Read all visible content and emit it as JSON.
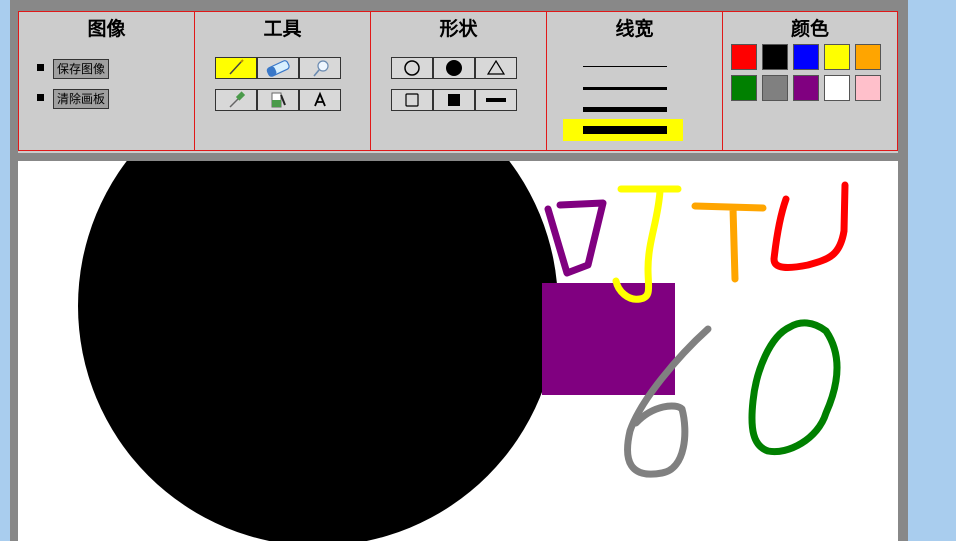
{
  "toolbar": {
    "image_panel": {
      "title": "图像",
      "save_label": "保存图像",
      "clear_label": "清除画板"
    },
    "tools_panel": {
      "title": "工具",
      "active_tool": "pencil"
    },
    "shapes_panel": {
      "title": "形状"
    },
    "width_panel": {
      "title": "线宽",
      "active_width_index": 3
    },
    "color_panel": {
      "title": "颜色",
      "colors": [
        "#ff0000",
        "#000000",
        "#0000ff",
        "#ffff00",
        "#ffa500",
        "#008000",
        "#808080",
        "#800080",
        "#ffffff",
        "#ffc0cb"
      ]
    }
  },
  "canvas": {
    "background": "#ffffff",
    "drawings": {
      "circle_color": "#000000",
      "rect_color": "#800080",
      "stroke_colors": {
        "letter_d": "#800080",
        "letter_j": "#ffff00",
        "letter_t": "#ffa500",
        "letter_u": "#ff0000",
        "digit_6": "#808080",
        "digit_0": "#008000"
      }
    }
  }
}
